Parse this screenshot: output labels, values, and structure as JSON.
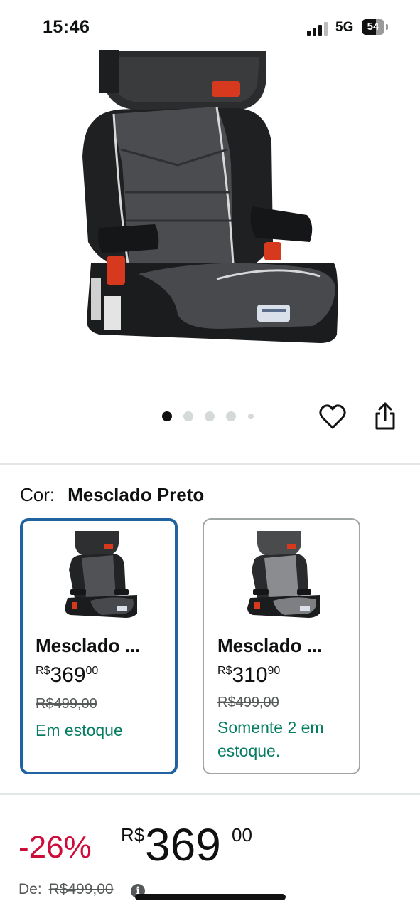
{
  "status_bar": {
    "time": "15:46",
    "network": "5G",
    "battery": "54"
  },
  "carousel": {
    "total_images": 5,
    "active_index": 0
  },
  "color_selector": {
    "label": "Cor:",
    "selected": "Mesclado Preto",
    "options": [
      {
        "name": "Mesclado ...",
        "price_currency": "R$",
        "price_whole": "369",
        "price_cents": "00",
        "old_price": "R$499,00",
        "stock": "Em estoque",
        "selected": true
      },
      {
        "name": "Mesclado ...",
        "price_currency": "R$",
        "price_whole": "310",
        "price_cents": "90",
        "old_price": "R$499,00",
        "stock": "Somente 2 em estoque.",
        "selected": false
      }
    ]
  },
  "pricing": {
    "discount": "-26%",
    "currency": "R$",
    "whole": "369",
    "cents": "00",
    "list_price_label": "De:",
    "list_price": "R$499,00",
    "info_glyph": "i"
  },
  "icons": [
    "wishlist-heart-icon",
    "share-icon",
    "info-icon",
    "signal-icon",
    "battery-icon"
  ],
  "colors": {
    "accent_selected": "#2162a1",
    "discount": "#cc0c39",
    "in_stock": "#067d62"
  }
}
